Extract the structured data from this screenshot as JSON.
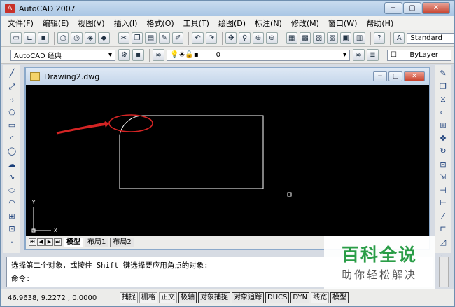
{
  "app": {
    "title": "AutoCAD 2007",
    "icon_glyph": "A",
    "window_controls": {
      "minimize": "−",
      "maximize": "▢",
      "close": "✕"
    }
  },
  "menu": [
    "文件(F)",
    "编辑(E)",
    "视图(V)",
    "插入(I)",
    "格式(O)",
    "工具(T)",
    "绘图(D)",
    "标注(N)",
    "修改(M)",
    "窗口(W)",
    "帮助(H)"
  ],
  "toolbar_standard": {
    "icons": [
      "new-icon",
      "open-icon",
      "save-icon",
      "print-icon",
      "preview-icon",
      "publish-icon",
      "plot-icon",
      "cut-icon",
      "copy-icon",
      "paste-icon",
      "matchprop-icon",
      "blockeditor-icon",
      "undo-icon",
      "redo-icon",
      "pan-icon",
      "zoom-realtime-icon",
      "zoom-window-icon",
      "zoom-previous-icon",
      "properties-icon",
      "designcenter-icon",
      "toolpalettes-icon",
      "sheetset-icon",
      "markup-icon",
      "calculator-icon",
      "help-icon"
    ],
    "text_style_label": "Standard"
  },
  "toolbar_workspace": {
    "workspace_value": "AutoCAD 经典",
    "layer_value": "0",
    "bylayer_label": "ByLayer"
  },
  "left_draw_tools": [
    "line-icon",
    "construction-line-icon",
    "polyline-icon",
    "polygon-icon",
    "rectangle-icon",
    "arc-icon",
    "circle-icon",
    "revcloud-icon",
    "spline-icon",
    "ellipse-icon",
    "ellipse-arc-icon",
    "insert-block-icon",
    "make-block-icon",
    "point-icon"
  ],
  "right_modify_tools": [
    "erase-icon",
    "copy-object-icon",
    "mirror-icon",
    "offset-icon",
    "array-icon",
    "move-icon",
    "rotate-icon",
    "scale-icon",
    "stretch-icon",
    "trim-icon",
    "extend-icon",
    "break-icon",
    "join-icon",
    "chamfer-icon",
    "fillet-icon"
  ],
  "document": {
    "title": "Drawing2.dwg",
    "tabs": [
      "模型",
      "布局1",
      "布局2"
    ],
    "ucs": {
      "x_label": "X",
      "y_label": "Y"
    }
  },
  "command": {
    "line1": "选择第二个对象，或按住 Shift 键选择要应用角点的对象:",
    "line2": "命令:"
  },
  "status": {
    "coords": "46.9638, 9.2272 , 0.0000",
    "buttons": [
      {
        "label": "捕捉",
        "on": false
      },
      {
        "label": "栅格",
        "on": false
      },
      {
        "label": "正交",
        "on": false
      },
      {
        "label": "极轴",
        "on": true
      },
      {
        "label": "对象捕捉",
        "on": true
      },
      {
        "label": "对象追踪",
        "on": true
      },
      {
        "label": "DUCS",
        "on": true
      },
      {
        "label": "DYN",
        "on": true
      },
      {
        "label": "线宽",
        "on": false
      },
      {
        "label": "模型",
        "on": true
      }
    ]
  },
  "watermark": {
    "main": "百科全说",
    "sub": "助你轻松解决"
  },
  "colors": {
    "canvas_bg": "#000000",
    "geometry": "#ffffff",
    "annotation_red": "#d42424",
    "watermark_green": "#2a9d47"
  }
}
